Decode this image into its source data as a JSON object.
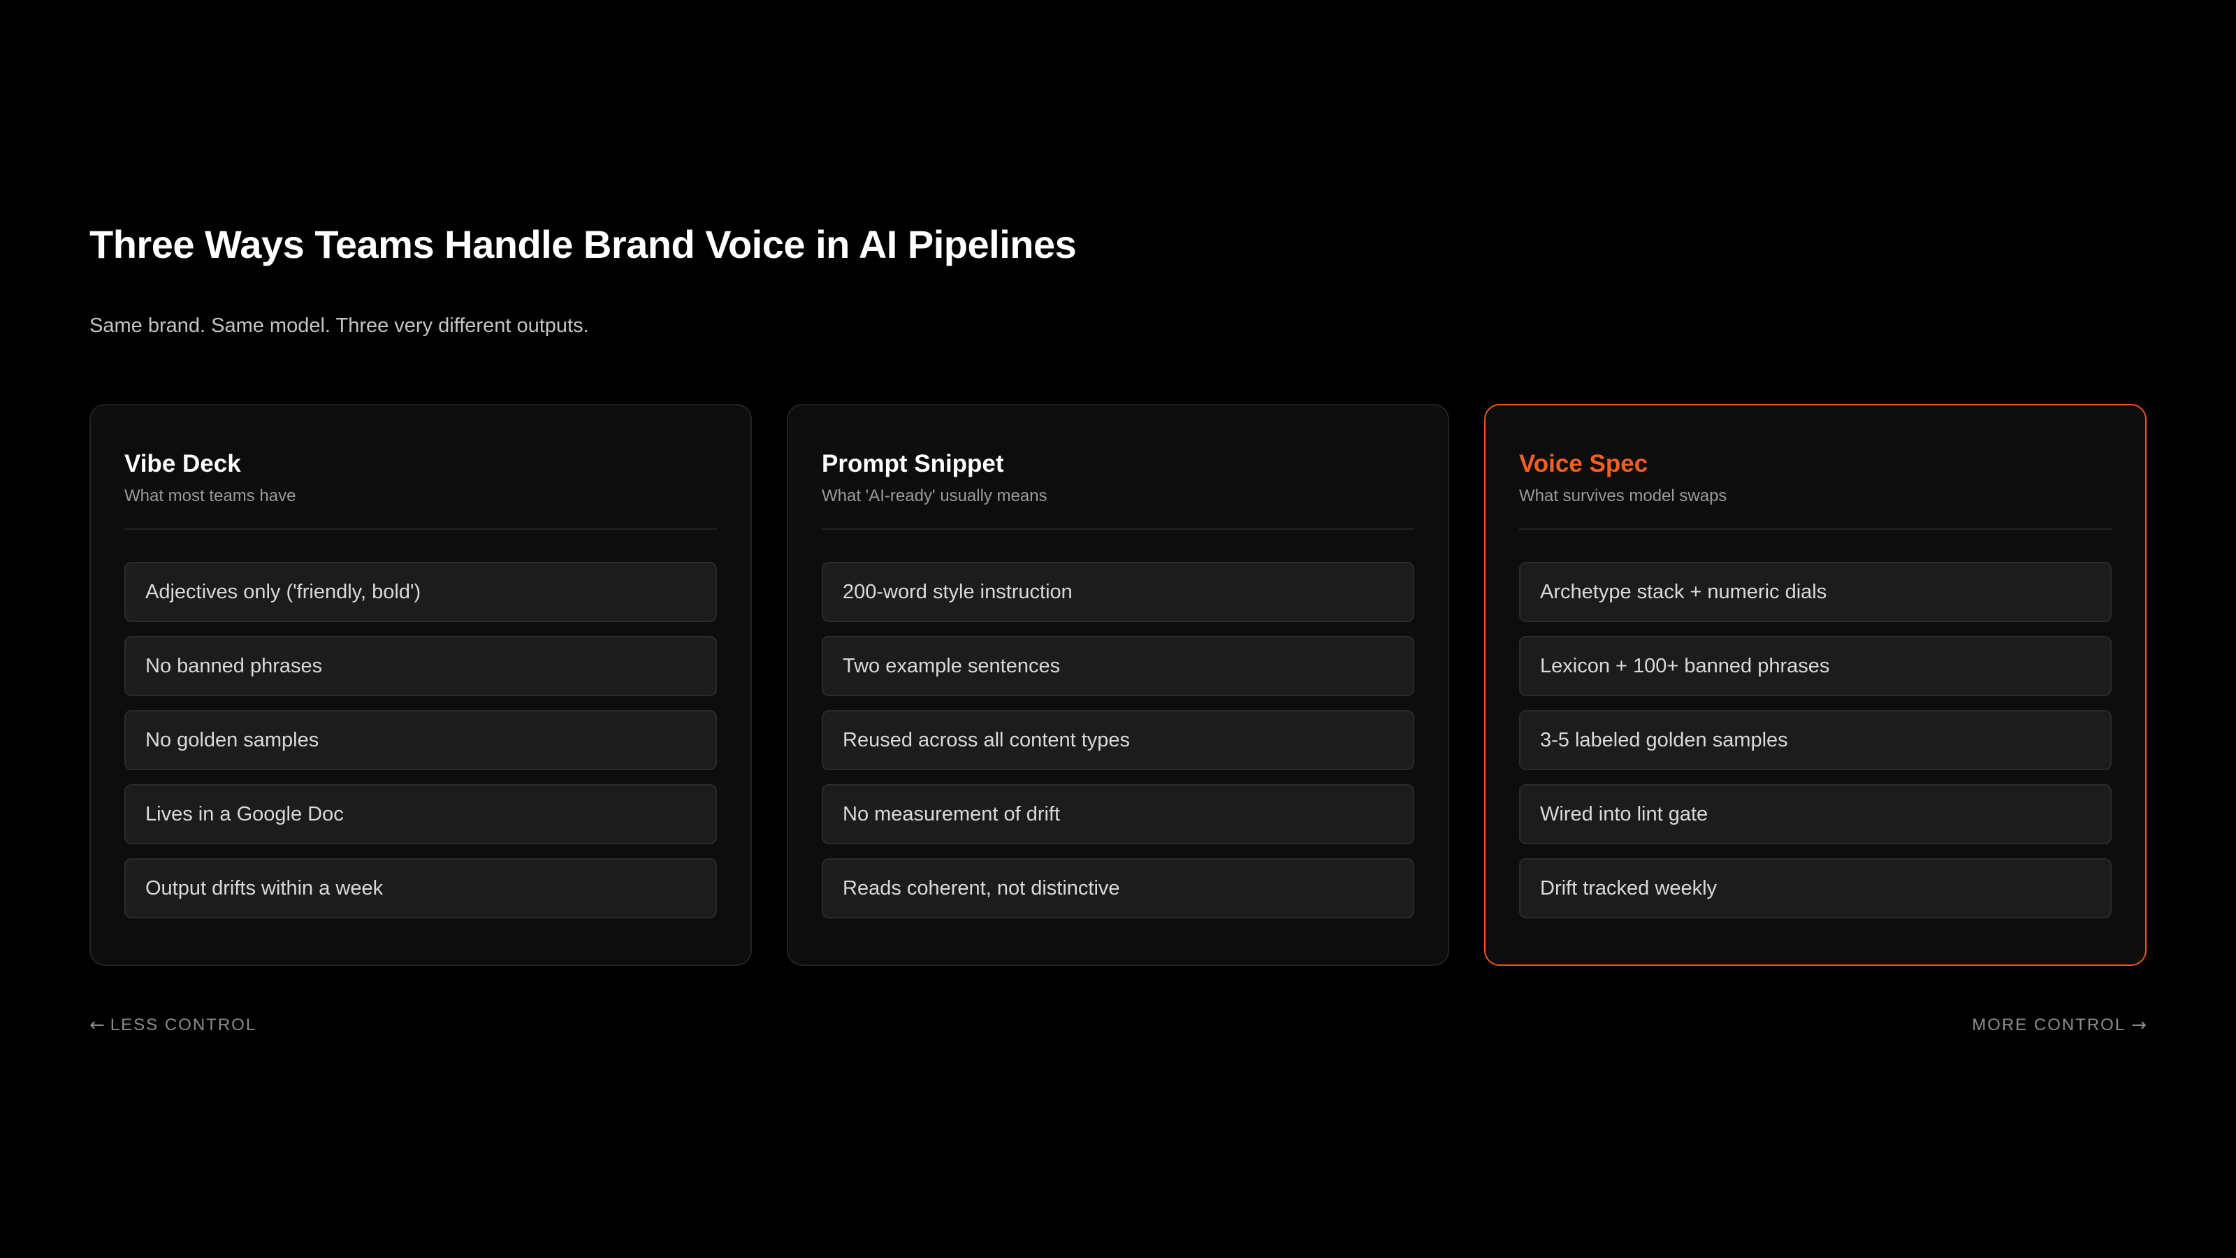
{
  "header": {
    "title": "Three Ways Teams Handle Brand Voice in AI Pipelines",
    "subtitle": "Same brand. Same model. Three very different outputs."
  },
  "colors": {
    "background": "#000000",
    "card_background": "#0d0d0d",
    "accent": "#f0601f"
  },
  "cards": [
    {
      "title": "Vibe Deck",
      "subtitle": "What most teams have",
      "highlighted": false,
      "items": [
        "Adjectives only ('friendly, bold')",
        "No banned phrases",
        "No golden samples",
        "Lives in a Google Doc",
        "Output drifts within a week"
      ]
    },
    {
      "title": "Prompt Snippet",
      "subtitle": "What 'AI-ready' usually means",
      "highlighted": false,
      "items": [
        "200-word style instruction",
        "Two example sentences",
        "Reused across all content types",
        "No measurement of drift",
        "Reads coherent, not distinctive"
      ]
    },
    {
      "title": "Voice Spec",
      "subtitle": "What survives model swaps",
      "highlighted": true,
      "items": [
        "Archetype stack + numeric dials",
        "Lexicon + 100+ banned phrases",
        "3-5 labeled golden samples",
        "Wired into lint gate",
        "Drift tracked weekly"
      ]
    }
  ],
  "axis": {
    "left_arrow": "←",
    "left_label": "LESS CONTROL",
    "right_label": "MORE CONTROL",
    "right_arrow": "→"
  }
}
